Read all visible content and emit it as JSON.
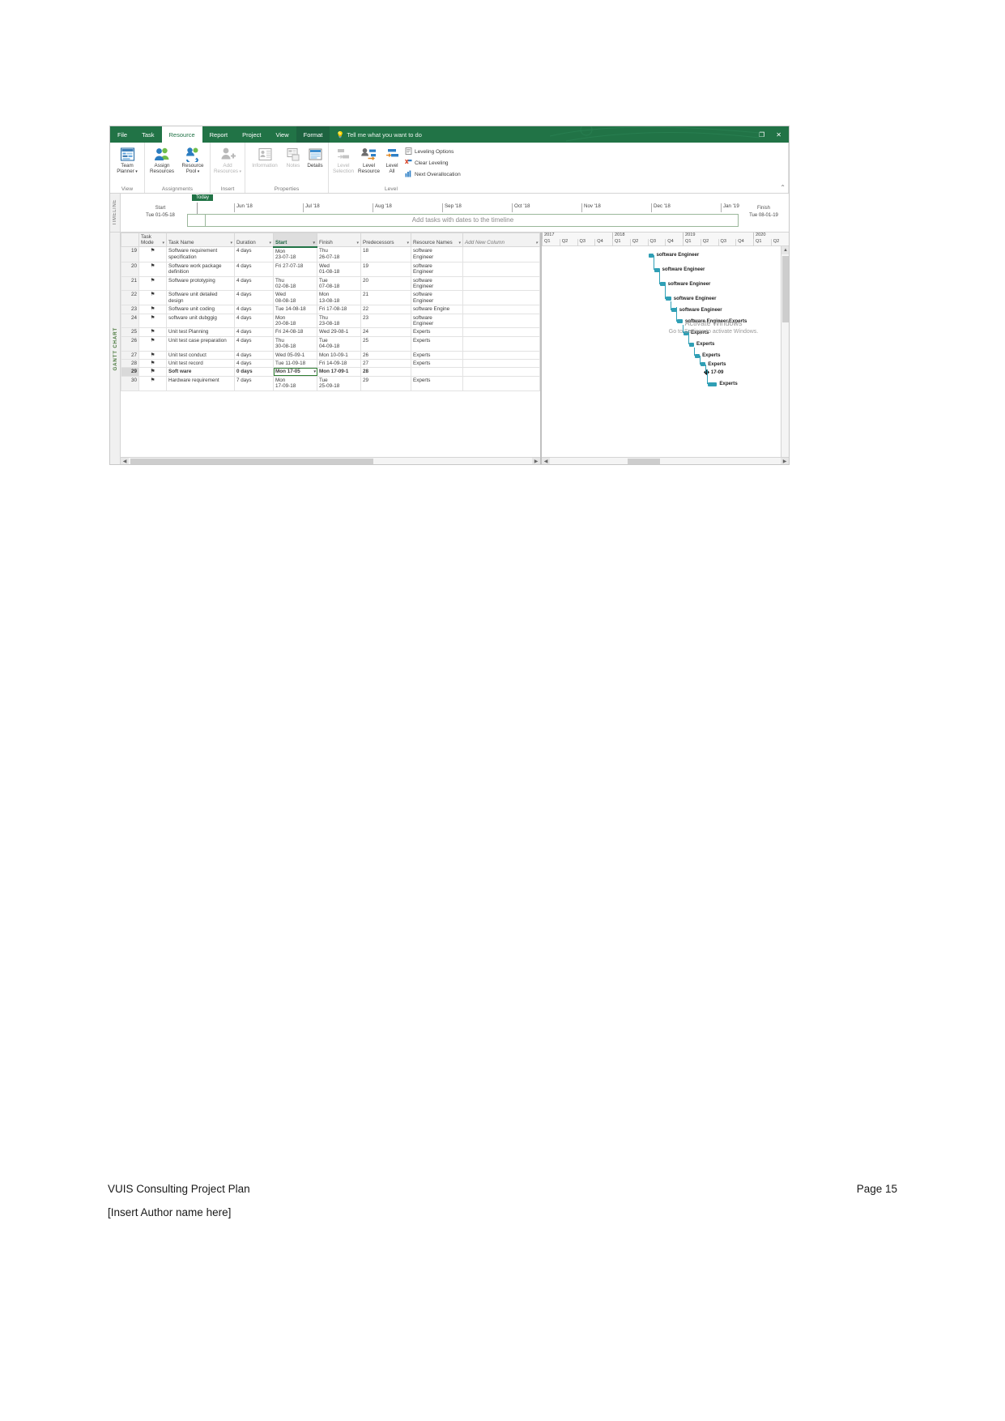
{
  "window": {
    "tabs": [
      {
        "label": "File",
        "state": "normal"
      },
      {
        "label": "Task",
        "state": "normal"
      },
      {
        "label": "Resource",
        "state": "active"
      },
      {
        "label": "Report",
        "state": "normal"
      },
      {
        "label": "Project",
        "state": "normal"
      },
      {
        "label": "View",
        "state": "normal"
      },
      {
        "label": "Format",
        "state": "contextual"
      }
    ],
    "tell_me": "Tell me what you want to do",
    "restore_label": "❐",
    "close_label": "✕",
    "collapse_ribbon": "⌃"
  },
  "ribbon": {
    "groups": [
      {
        "name": "View",
        "buttons": [
          {
            "line1": "Team",
            "line2": "Planner",
            "icon": "team-planner-icon",
            "disabled": false,
            "caret": true
          }
        ]
      },
      {
        "name": "Assignments",
        "buttons": [
          {
            "line1": "Assign",
            "line2": "Resources",
            "icon": "assign-resources-icon",
            "disabled": false,
            "caret": false
          },
          {
            "line1": "Resource",
            "line2": "Pool",
            "icon": "resource-pool-icon",
            "disabled": false,
            "caret": true
          }
        ]
      },
      {
        "name": "Insert",
        "buttons": [
          {
            "line1": "Add",
            "line2": "Resources",
            "icon": "add-resources-icon",
            "disabled": true,
            "caret": true
          }
        ]
      },
      {
        "name": "Properties",
        "buttons": [
          {
            "line1": "Information",
            "line2": "",
            "icon": "information-icon",
            "disabled": true,
            "caret": false
          },
          {
            "line1": "Notes",
            "line2": "",
            "icon": "notes-icon",
            "disabled": true,
            "caret": false
          },
          {
            "line1": "Details",
            "line2": "",
            "icon": "details-icon",
            "disabled": false,
            "caret": false
          }
        ]
      },
      {
        "name": "Level",
        "buttons": [
          {
            "line1": "Level",
            "line2": "Selection",
            "icon": "level-selection-icon",
            "disabled": true,
            "caret": false
          },
          {
            "line1": "Level",
            "line2": "Resource",
            "icon": "level-resource-icon",
            "disabled": false,
            "caret": false
          },
          {
            "line1": "Level",
            "line2": "All",
            "icon": "level-all-icon",
            "disabled": false,
            "caret": false
          }
        ],
        "small_buttons": [
          {
            "label": "Leveling Options",
            "icon": "leveling-options-icon"
          },
          {
            "label": "Clear Leveling",
            "icon": "clear-leveling-icon"
          },
          {
            "label": "Next Overallocation",
            "icon": "next-overallocation-icon"
          }
        ]
      }
    ]
  },
  "timeline": {
    "vtab_label": "TIMELINE",
    "today_label": "Today",
    "start_label": "Start",
    "start_value": "Tue 01-05-18",
    "finish_label": "Finish",
    "finish_value": "Tue 08-01-19",
    "hint": "Add tasks with dates to the timeline",
    "months": [
      "Jun '18",
      "Jul '18",
      "Aug '18",
      "Sep '18",
      "Oct '18",
      "Nov '18",
      "Dec '18",
      "Jan '19"
    ]
  },
  "gantt": {
    "vtab_label": "GANTT CHART",
    "columns": [
      {
        "label": "Task\nMode",
        "key": "mode",
        "selected": false
      },
      {
        "label": "Task Name",
        "key": "name",
        "selected": false
      },
      {
        "label": "Duration",
        "key": "duration",
        "selected": false
      },
      {
        "label": "Start",
        "key": "start",
        "selected": true
      },
      {
        "label": "Finish",
        "key": "finish",
        "selected": false
      },
      {
        "label": "Predecessors",
        "key": "predecessors",
        "selected": false
      },
      {
        "label": "Resource\nNames",
        "key": "resources",
        "selected": false
      },
      {
        "label": "Add New Column",
        "key": "addnew",
        "selected": false
      }
    ],
    "rows": [
      {
        "id": "19",
        "mode": "⚑",
        "name": "Software requirement specification",
        "duration": "4 days",
        "start": "Mon\n23-07-18",
        "finish": "Thu\n26-07-18",
        "predecessors": "18",
        "resources": "software\nEngineer",
        "selected": false
      },
      {
        "id": "20",
        "mode": "⚑",
        "name": "Software work package definition",
        "duration": "4 days",
        "start": "Fri 27-07-18",
        "finish": "Wed\n01-08-18",
        "predecessors": "19",
        "resources": "software\nEngineer",
        "selected": false
      },
      {
        "id": "21",
        "mode": "⚑",
        "name": "Software prototyping",
        "duration": "4 days",
        "start": "Thu\n02-08-18",
        "finish": "Tue\n07-08-18",
        "predecessors": "20",
        "resources": "software\nEngineer",
        "selected": false
      },
      {
        "id": "22",
        "mode": "⚑",
        "name": "Software unit detailed design",
        "duration": "4 days",
        "start": "Wed\n08-08-18",
        "finish": "Mon\n13-08-18",
        "predecessors": "21",
        "resources": "software\nEngineer",
        "selected": false
      },
      {
        "id": "23",
        "mode": "⚑",
        "name": "Software unit coding",
        "duration": "4 days",
        "start": "Tue 14-08-18",
        "finish": "Fri 17-08-18",
        "predecessors": "22",
        "resources": "software Engine",
        "selected": false
      },
      {
        "id": "24",
        "mode": "⚑",
        "name": "software unit dubggig",
        "duration": "4 days",
        "start": "Mon\n20-08-18",
        "finish": "Thu\n23-08-18",
        "predecessors": "23",
        "resources": "software\nEngineer",
        "selected": false
      },
      {
        "id": "25",
        "mode": "⚑",
        "name": "Unit test Planning",
        "duration": "4 days",
        "start": "Fri 24-08-18",
        "finish": "Wed 29-08-1",
        "predecessors": "24",
        "resources": "Experts",
        "selected": false
      },
      {
        "id": "26",
        "mode": "⚑",
        "name": "Unit test case preparation",
        "duration": "4 days",
        "start": "Thu\n30-08-18",
        "finish": "Tue\n04-09-18",
        "predecessors": "25",
        "resources": "Experts",
        "selected": false
      },
      {
        "id": "27",
        "mode": "⚑",
        "name": "Unit test conduct",
        "duration": "4 days",
        "start": "Wed 05-09-1",
        "finish": "Mon 10-09-1",
        "predecessors": "26",
        "resources": "Experts",
        "selected": false
      },
      {
        "id": "28",
        "mode": "⚑",
        "name": "Unit test record",
        "duration": "4 days",
        "start": "Tue 11-09-18",
        "finish": "Fri 14-09-18",
        "predecessors": "27",
        "resources": "Experts",
        "selected": false
      },
      {
        "id": "29",
        "mode": "⚑",
        "name": "Soft ware",
        "duration": "0 days",
        "start": "Mon 17-05",
        "finish": "Mon 17-09-1",
        "predecessors": "28",
        "resources": "",
        "selected": true
      },
      {
        "id": "30",
        "mode": "⚑",
        "name": "Hardware requirement",
        "duration": "7 days",
        "start": "Mon\n17-09-18",
        "finish": "Tue\n25-09-18",
        "predecessors": "29",
        "resources": "Experts",
        "selected": false
      }
    ]
  },
  "chart_data": {
    "type": "bar",
    "title": "Gantt Chart",
    "year_headers": [
      "2017",
      "2018",
      "2019",
      "2020"
    ],
    "quarter_headers": [
      "Q1",
      "Q2",
      "Q3",
      "Q4",
      "Q1",
      "Q2",
      "Q3",
      "Q4",
      "Q1",
      "Q2",
      "Q3",
      "Q4",
      "Q1",
      "Q2"
    ],
    "bars": [
      {
        "row": "19",
        "label": "software Engineer",
        "start": "Mon 23-07-18",
        "finish": "Thu 26-07-18",
        "days": 4
      },
      {
        "row": "20",
        "label": "software Engineer",
        "start": "Fri 27-07-18",
        "finish": "Wed 01-08-18",
        "days": 4
      },
      {
        "row": "21",
        "label": "software Engineer",
        "start": "Thu 02-08-18",
        "finish": "Tue 07-08-18",
        "days": 4
      },
      {
        "row": "22",
        "label": "software Engineer",
        "start": "Wed 08-08-18",
        "finish": "Mon 13-08-18",
        "days": 4
      },
      {
        "row": "23",
        "label": "software Engineer",
        "start": "Tue 14-08-18",
        "finish": "Fri 17-08-18",
        "days": 4
      },
      {
        "row": "24",
        "label": "software Engineer,Experts",
        "start": "Mon 20-08-18",
        "finish": "Thu 23-08-18",
        "days": 4
      },
      {
        "row": "25",
        "label": "Experts",
        "start": "Fri 24-08-18",
        "finish": "Wed 29-08-18",
        "days": 4
      },
      {
        "row": "26",
        "label": "Experts",
        "start": "Thu 30-08-18",
        "finish": "Tue 04-09-18",
        "days": 4
      },
      {
        "row": "27",
        "label": "Experts",
        "start": "Wed 05-09-18",
        "finish": "Mon 10-09-18",
        "days": 4
      },
      {
        "row": "28",
        "label": "Experts",
        "start": "Tue 11-09-18",
        "finish": "Fri 14-09-18",
        "days": 4
      },
      {
        "row": "29",
        "label": "17-09",
        "start": "Mon 17-09-18",
        "finish": "Mon 17-09-18",
        "days": 0,
        "milestone": true
      },
      {
        "row": "30",
        "label": "Experts",
        "start": "Mon 17-09-18",
        "finish": "Tue 25-09-18",
        "days": 7
      }
    ]
  },
  "watermark": {
    "line1": "Activate Windows",
    "line2": "Go to Settings to activate Windows."
  },
  "scrollbars": {
    "left_arrow": "◀",
    "right_arrow": "▶",
    "up_arrow": "▲",
    "down_arrow": "▼"
  },
  "page": {
    "doc_title": "VUIS Consulting Project Plan",
    "page_number": "Page 15",
    "author_placeholder": "[Insert Author name here]"
  }
}
